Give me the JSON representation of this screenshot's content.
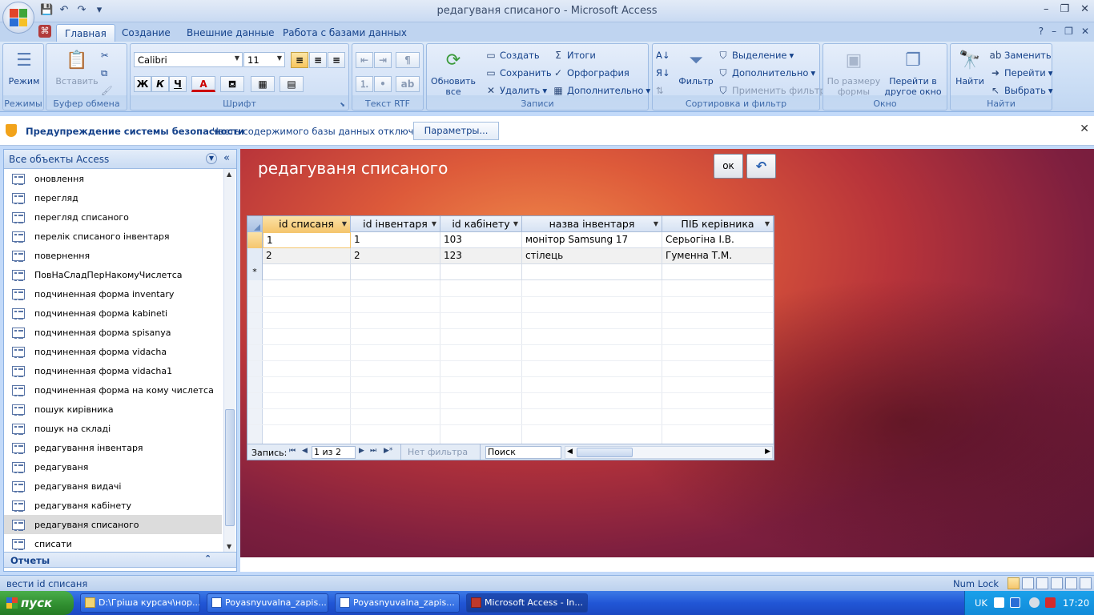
{
  "window": {
    "title": "редагуваня списаного - Microsoft Access"
  },
  "tabs": [
    "Главная",
    "Создание",
    "Внешние данные",
    "Работа с базами данных"
  ],
  "ribbon": {
    "views": {
      "label": "Режим",
      "group": "Режимы"
    },
    "clipboard": {
      "paste": "Вставить",
      "group": "Буфер обмена"
    },
    "font": {
      "name": "Calibri",
      "size": "11",
      "group": "Шрифт",
      "bold": "Ж",
      "italic": "К",
      "underline": "Ч",
      "color": "A"
    },
    "rtf": {
      "group": "Текст RTF"
    },
    "records": {
      "refresh": "Обновить все",
      "new": "Создать",
      "save": "Сохранить",
      "delete": "Удалить",
      "totals": "Итоги",
      "spelling": "Орфография",
      "more": "Дополнительно",
      "group": "Записи"
    },
    "sort": {
      "filter": "Фильтр",
      "selection": "Выделение",
      "advanced": "Дополнительно",
      "apply": "Применить фильтр",
      "group": "Сортировка и фильтр"
    },
    "window": {
      "fit": "По размеру формы",
      "switch": "Перейти в другое окно",
      "group": "Окно"
    },
    "find": {
      "find": "Найти",
      "replace": "Заменить",
      "goto": "Перейти",
      "select": "Выбрать",
      "group": "Найти"
    }
  },
  "security": {
    "title": "Предупреждение системы безопасности",
    "message": "Часть содержимого базы данных отключено",
    "button": "Параметры..."
  },
  "nav": {
    "title": "Все объекты Access",
    "items": [
      "оновлення",
      "перегляд",
      "перегляд списаного",
      "перелік списаного інвентаря",
      "повернення",
      "ПовНаСладПерНакомуЧислетса",
      "подчиненная форма inventary",
      "подчиненная форма kabineti",
      "подчиненная форма spisanya",
      "подчиненная форма vidacha",
      "подчиненная форма vidacha1",
      "подчиненная форма на кому числетса",
      "пошук кирівника",
      "пошук на складі",
      "редагування інвентаря",
      "редагуваня",
      "редагуваня видачі",
      "редагуваня кабінету",
      "редагуваня списаного",
      "списати"
    ],
    "selected_index": 18,
    "group_reports": "Отчеты"
  },
  "form": {
    "title": "редагуваня списаного",
    "ok": "ок",
    "undo_icon": "undo-icon"
  },
  "datasheet": {
    "columns": [
      "id списаня",
      "id інвентаря",
      "id кабінету",
      "назва інвентаря",
      "ПІБ керівника"
    ],
    "rows": [
      [
        "1",
        "1",
        "103",
        "монітор Samsung 17",
        "Серьогіна І.В."
      ],
      [
        "2",
        "2",
        "123",
        "стілець",
        "Гуменна Т.М."
      ]
    ],
    "new_row_marker": "*",
    "nav": {
      "label": "Запись:",
      "record": "1 из 2",
      "filter": "Нет фильтра",
      "search": "Поиск"
    }
  },
  "status": {
    "text": "вести id списаня",
    "numlock": "Num Lock"
  },
  "taskbar": {
    "start": "пуск",
    "tasks": [
      "D:\\Гріша курсач\\нор...",
      "Poyasnyuvalna_zapis...",
      "Poyasnyuvalna_zapis...",
      "Microsoft Access - In..."
    ],
    "lang": "UK",
    "time": "17:20"
  }
}
